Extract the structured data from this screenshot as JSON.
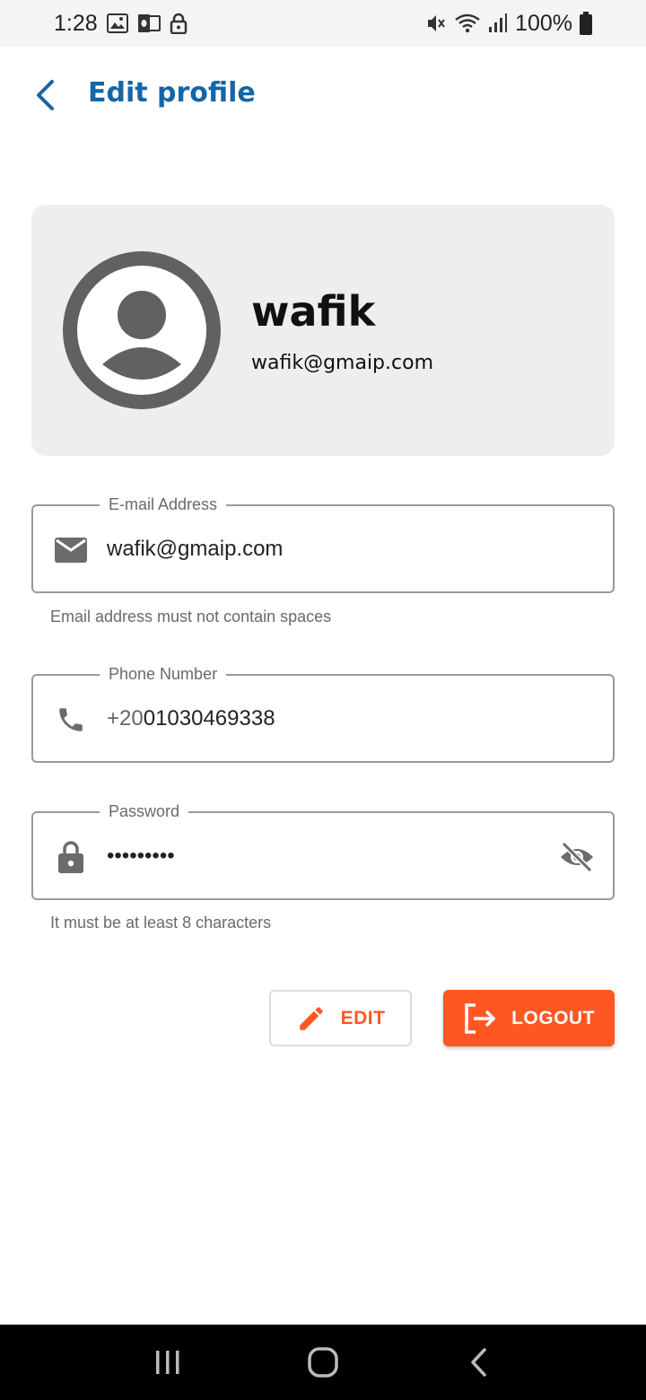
{
  "status_bar": {
    "time": "1:28",
    "battery": "100%",
    "icons": [
      "gallery-icon",
      "outlook-icon",
      "lock-icon",
      "mute-icon",
      "wifi-icon",
      "signal-icon",
      "battery-icon"
    ]
  },
  "header": {
    "title": "Edit profile",
    "back_icon": "chevron-left-icon"
  },
  "profile": {
    "name": "wafik",
    "email": "wafik@gmaip.com",
    "avatar_icon": "account-circle-icon"
  },
  "form": {
    "email": {
      "label": "E-mail Address",
      "value": "wafik@gmaip.com",
      "helper": "Email address must not contain spaces",
      "icon": "mail-icon"
    },
    "phone": {
      "label": "Phone Number",
      "prefix": "+20",
      "value": "01030469338",
      "icon": "phone-icon"
    },
    "password": {
      "label": "Password",
      "value": "•••••••••",
      "helper": "It must be at least 8 characters",
      "icon": "lock-icon",
      "toggle_icon": "eye-off-icon"
    }
  },
  "actions": {
    "edit_label": "EDIT",
    "logout_label": "LOGOUT"
  },
  "colors": {
    "accent": "#ff5722",
    "title": "#1565a8",
    "card": "#eeeeee",
    "icon_gray": "#666666"
  },
  "nav": {
    "items": [
      "recents-icon",
      "home-icon",
      "back-icon"
    ]
  }
}
